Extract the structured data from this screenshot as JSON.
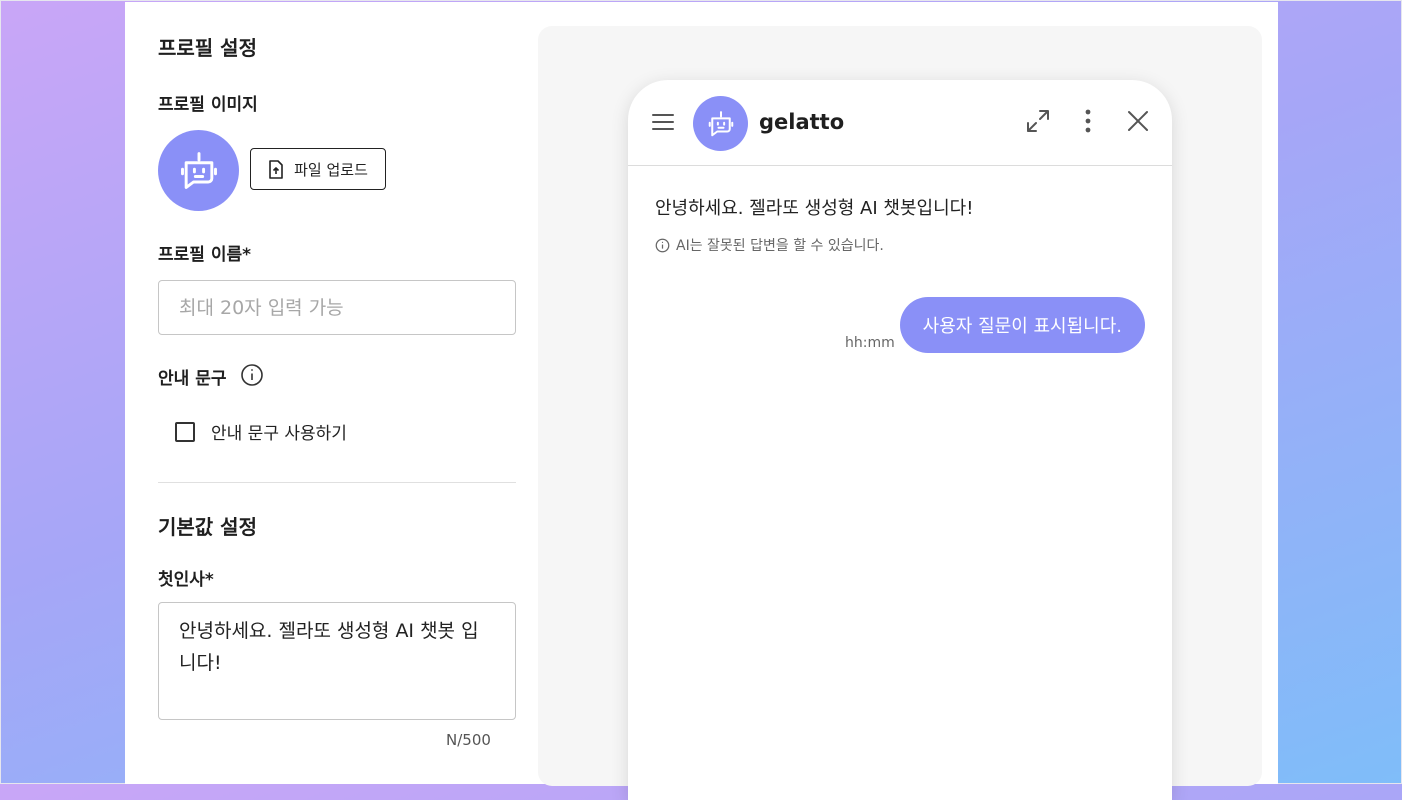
{
  "form": {
    "profile_section_title": "프로필 설정",
    "profile_image_label": "프로필 이미지",
    "upload_button_label": "파일 업로드",
    "profile_name_label": "프로필 이름*",
    "profile_name_placeholder": "최대 20자 입력 가능",
    "guide_label": "안내 문구",
    "guide_checkbox_label": "안내 문구 사용하기",
    "guide_checkbox_checked": false,
    "default_section_title": "기본값 설정",
    "first_greeting_label": "첫인사*",
    "first_greeting_value": "안녕하세요. 젤라또 생성형 AI 챗봇 입니다!",
    "char_counter": "N/500"
  },
  "preview": {
    "bot_name": "gelatto",
    "greeting_message": "안녕하세요. 젤라또 생성형 AI 챗봇입니다!",
    "ai_notice": "AI는 잘못된 답변을 할 수 있습니다.",
    "user_message": "사용자 질문이 표시됩니다.",
    "message_time": "hh:mm"
  },
  "colors": {
    "accent": "#8a90f7",
    "background_gradient_start": "#c9a6f7",
    "background_gradient_end": "#7fbdf9"
  },
  "icons": {
    "bot": "robot-icon",
    "upload": "file-upload-icon",
    "info": "info-icon",
    "menu": "hamburger-menu-icon",
    "expand": "expand-icon",
    "more": "more-vertical-icon",
    "close": "close-icon"
  }
}
